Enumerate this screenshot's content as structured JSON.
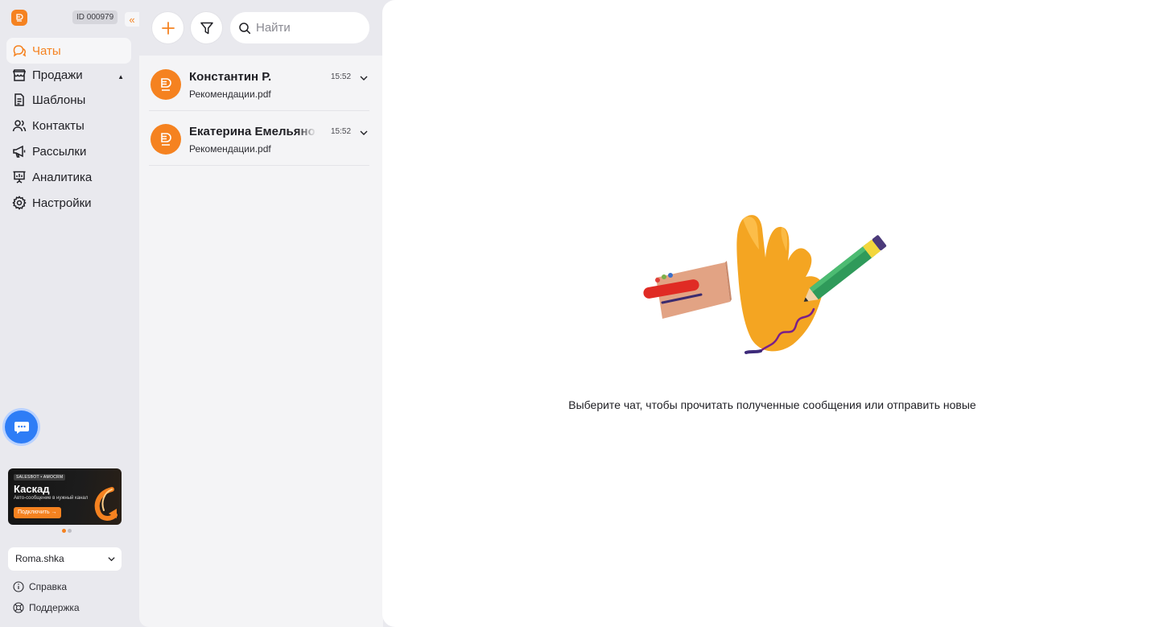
{
  "app": {
    "account_id": "ID 000979",
    "collapse_label": "«"
  },
  "sidebar": {
    "items": [
      {
        "label": "Чаты",
        "icon": "chat-icon"
      },
      {
        "label": "Продажи",
        "icon": "store-icon"
      },
      {
        "label": "Шаблоны",
        "icon": "document-icon"
      },
      {
        "label": "Контакты",
        "icon": "contacts-icon"
      },
      {
        "label": "Рассылки",
        "icon": "megaphone-icon"
      },
      {
        "label": "Аналитика",
        "icon": "presentation-icon"
      },
      {
        "label": "Настройки",
        "icon": "gear-icon"
      }
    ],
    "active_item": "Чаты",
    "promo": {
      "tag": "SALESBOT • AMOCRM",
      "title": "Каскад",
      "subtitle": "Авто-сообщение в нужный канал",
      "cta": "Подключить →"
    },
    "account_name": "Roma.shka",
    "help_label": "Справка",
    "support_label": "Поддержка"
  },
  "chatlist": {
    "search_placeholder": "Найти",
    "chats": [
      {
        "name": "Константин Р.",
        "time": "15:52",
        "preview": "Рекомендации.pdf"
      },
      {
        "name": "Екатерина Емельянова",
        "time": "15:52",
        "preview": "Рекомендации.pdf"
      }
    ]
  },
  "main": {
    "empty_text": "Выберите чат, чтобы прочитать полученные сообщения или отправить новые"
  },
  "colors": {
    "accent": "#f58220",
    "sidebar_bg": "#e9e9ee",
    "chat_button": "#2e7df6"
  }
}
